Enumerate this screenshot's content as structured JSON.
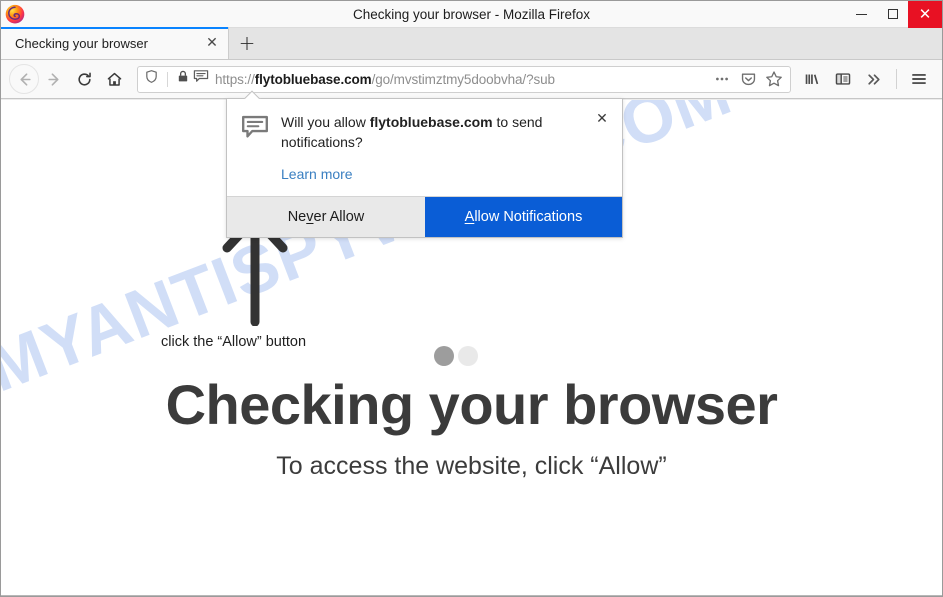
{
  "window": {
    "title": "Checking your browser - Mozilla Firefox",
    "logo_icon": "firefox-logo",
    "controls": {
      "minimize": "minimize-icon",
      "maximize": "maximize-icon",
      "close": "close-icon"
    }
  },
  "tabs": {
    "items": [
      {
        "title": "Checking your browser",
        "close_icon": "close-icon",
        "active": true
      }
    ],
    "new_tab_label": "+",
    "new_tab_icon": "plus-icon"
  },
  "toolbar": {
    "back_icon": "back-arrow-icon",
    "forward_icon": "forward-arrow-icon",
    "reload_icon": "reload-icon",
    "home_icon": "home-icon",
    "library_icon": "library-icon",
    "sidebar_icon": "sidebar-icon",
    "overflow_icon": "chevron-double-right-icon",
    "menu_icon": "hamburger-menu-icon"
  },
  "urlbar": {
    "shield_icon": "tracking-protection-shield-icon",
    "lock_icon": "padlock-icon",
    "notification_icon": "notification-bubble-icon",
    "url_scheme": "https://",
    "url_host": "flytobluebase.com",
    "url_path": "/go/mvstimztmy5doobvha/?sub",
    "page_actions_icon": "ellipsis-icon",
    "pocket_icon": "pocket-icon",
    "bookmark_icon": "star-icon"
  },
  "popup": {
    "icon": "notification-bubble-icon",
    "question_prefix": "Will you allow ",
    "question_domain": "flytobluebase.com",
    "question_suffix": " to send notifications?",
    "learn_more": "Learn more",
    "close_icon": "close-icon",
    "never_allow": {
      "pre": "Ne",
      "accesskey": "v",
      "post": "er Allow"
    },
    "allow": {
      "accesskey": "A",
      "post": "llow Notifications"
    },
    "accent_color": "#0a5dd6",
    "never_bg": "#e9e9e9"
  },
  "page": {
    "watermark": "MYANTISPYWARE.COM",
    "watermark_color": "#cfddf7",
    "arrow_icon": "up-arrow-icon",
    "arrow_caption": "click the “Allow” button",
    "loader": {
      "dot1_color": "#9d9d9d",
      "dot2_color": "#e9e9e9"
    },
    "heading": "Checking your browser",
    "subheading": "To access the website, click “Allow”"
  }
}
